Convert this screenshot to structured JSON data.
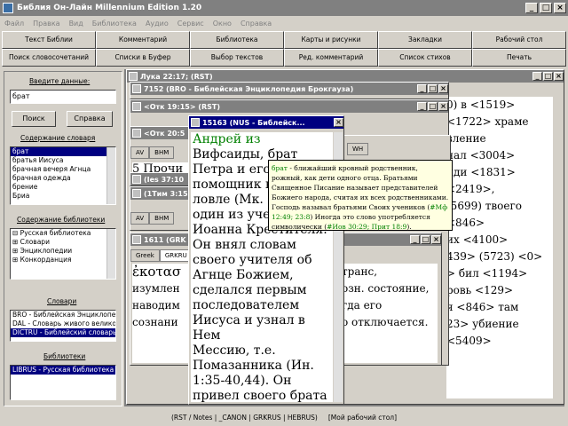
{
  "window": {
    "title": "Библия Он-Лайн Millennium Edition 1.20",
    "min": "_",
    "max": "□",
    "close": "×"
  },
  "menu": [
    "Файл",
    "Правка",
    "Вид",
    "Библиотека",
    "Аудио",
    "Сервис",
    "Окно",
    "Справка"
  ],
  "toolbar": {
    "row1": [
      "Текст Библии",
      "Комментарий",
      "Библиотека",
      "Карты и рисунки",
      "Закладки",
      "Рабочий стол"
    ],
    "row2": [
      "Поиск словосочетаний",
      "Списки в Буфер",
      "Выбор текстов",
      "Ред. комментарий",
      "Список стихов",
      "Печать"
    ]
  },
  "left": {
    "input_label": "Введите данные:",
    "input_value": "брат",
    "search_btn": "Поиск",
    "help_btn": "Справка",
    "dict_label": "Содержание словаря",
    "dict_items": [
      "брат",
      "братья Иисуса",
      "брачная вечеря Агнца",
      "брачная одежда",
      "брение",
      "Бриа"
    ],
    "lib_label": "Содержание библиотеки",
    "lib_items": [
      "⊟ Русская библиотека",
      "  ⊞ Словари",
      "  ⊞ Энциклопедии",
      "  ⊞ Конкорданция"
    ],
    "dicts_label": "Словари",
    "dicts_items": [
      "BRO - Библейская Энциклопедия",
      "DAL - Словарь живого велико",
      "DICTRU - Библейский словарь"
    ],
    "libs_label": "Библиотеки",
    "libs_items": [
      "LIBRUS - Русская библиотека"
    ]
  },
  "mdi": {
    "w_luke": "Лука 22:17; (RST)",
    "w_7152": "7152 (BRO - Библейская Энциклопедия Брокгауза)",
    "w_otk19": "<Отк 19:15> (RST)",
    "w_otk20": "<Отк 20:5",
    "w_15163": "15163 (NUS - Библейск...",
    "w_ies": "(Ies 37:10",
    "w_tim": "(1Тим 3:15",
    "w_1611": "1611 (GRK",
    "tabs_av": [
      "AV",
      "BHM"
    ],
    "tab_wh": "WH",
    "tabs_greek": [
      "Greek",
      "GRKRU"
    ],
    "main_text": [
      "Андрей из",
      "Вифсаиды, брат",
      "Петра и его",
      "помощник в",
      "ловле (Мк. 1:",
      "один из учен",
      "Иоанна Крестителя.",
      "Он внял словам",
      "своего учителя об",
      "Агнце Божием,",
      "сделался первым",
      "последователем",
      "Иисуса и узнал в Нем",
      "Мессию, т.е.",
      "Помазанника (Ин.",
      "1:35-40,44). Он",
      "привел своего брата"
    ],
    "greek_text": [
      "ἐκοτασ",
      "изумлен",
      "наводим",
      "сознани"
    ],
    "greek_right": [
      "транс,",
      "озн. состояние,",
      "гда его",
      "о отключается."
    ],
    "right_text": [
      "0) в <1519>",
      "<1722> храме",
      "вление",
      "",
      "нал <3004>",
      "йди <1831>",
      "<2419>,",
      "(5699) твоего",
      "",
      "<846>",
      "их <4100>",
      "439> (5723) <0>",
      "> бил <1194>",
      "",
      "ровь <129>",
      "я <846> там",
      "23> убиение",
      "<5409>"
    ],
    "prochi": "5 Прочи"
  },
  "tooltip": {
    "pre": "брат",
    "body": " - ближайший кровный родственник, рожный, как дети одного отца. Братьями Священное Писание называет представителей Божиего народа, считая их всех родственниками. Господь называл братьями Своих учеников (",
    "ref1": "#Мф 12:49; 23:8",
    "mid": ") Иногда это слово употребляется символически (",
    "ref2": "#Иов 30:29; Прит 18:9",
    "end": ")."
  },
  "status": [
    "(RST / Notes | _CANON | GRKRUS | HEBRUS)",
    "[Мой рабочий стол]"
  ]
}
